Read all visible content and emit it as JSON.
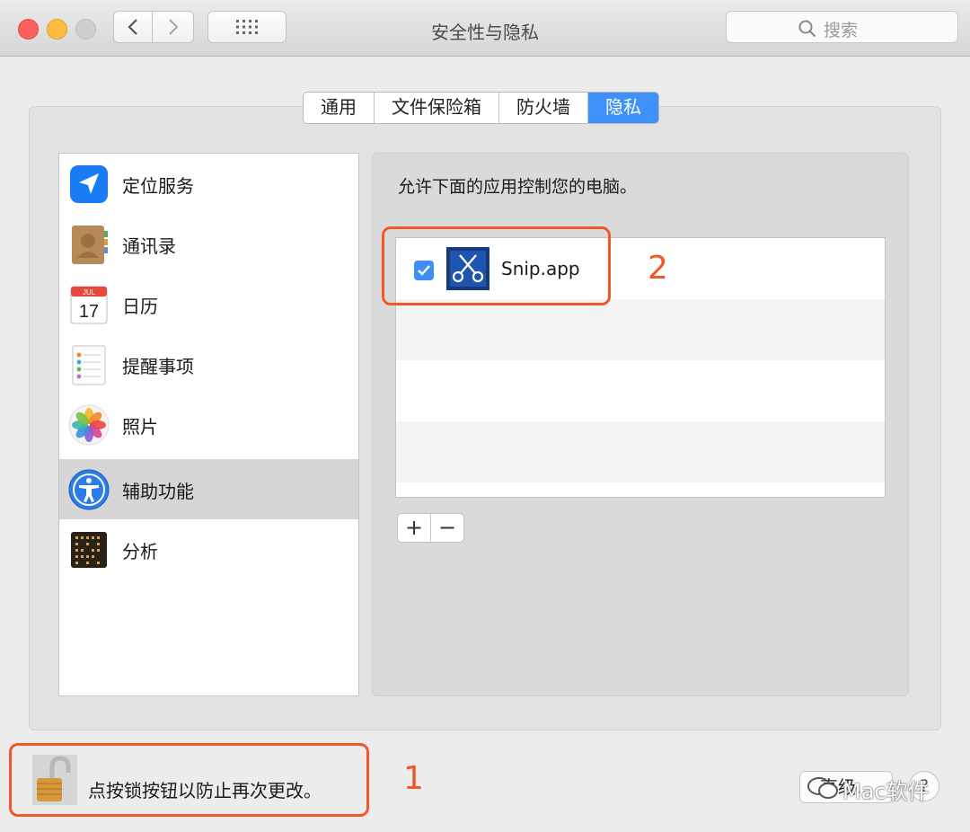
{
  "window": {
    "title": "安全性与隐私",
    "search_placeholder": "搜索"
  },
  "tabs": [
    {
      "label": "通用",
      "active": false
    },
    {
      "label": "文件保险箱",
      "active": false
    },
    {
      "label": "防火墙",
      "active": false
    },
    {
      "label": "隐私",
      "active": true
    }
  ],
  "sidebar": {
    "items": [
      {
        "label": "定位服务",
        "icon": "location-arrow-icon"
      },
      {
        "label": "通讯录",
        "icon": "contacts-book-icon"
      },
      {
        "label": "日历",
        "icon": "calendar-icon",
        "icon_month": "JUL",
        "icon_day": "17"
      },
      {
        "label": "提醒事项",
        "icon": "reminders-icon"
      },
      {
        "label": "照片",
        "icon": "photos-icon"
      },
      {
        "label": "辅助功能",
        "icon": "accessibility-icon",
        "selected": true
      },
      {
        "label": "分析",
        "icon": "analytics-icon"
      }
    ]
  },
  "main": {
    "header": "允许下面的应用控制您的电脑。",
    "apps": [
      {
        "name": "Snip.app",
        "checked": true,
        "icon": "scissors-app-icon"
      }
    ],
    "add_label": "+",
    "remove_label": "−"
  },
  "footer": {
    "lock_text": "点按锁按钮以防止再次更改。",
    "advanced_label": "高级...",
    "help_label": "?"
  },
  "annotations": {
    "label_1": "1",
    "label_2": "2"
  },
  "watermark": "Mac软件",
  "colors": {
    "accent": "#3f90f8",
    "annotation": "#f1572a"
  }
}
